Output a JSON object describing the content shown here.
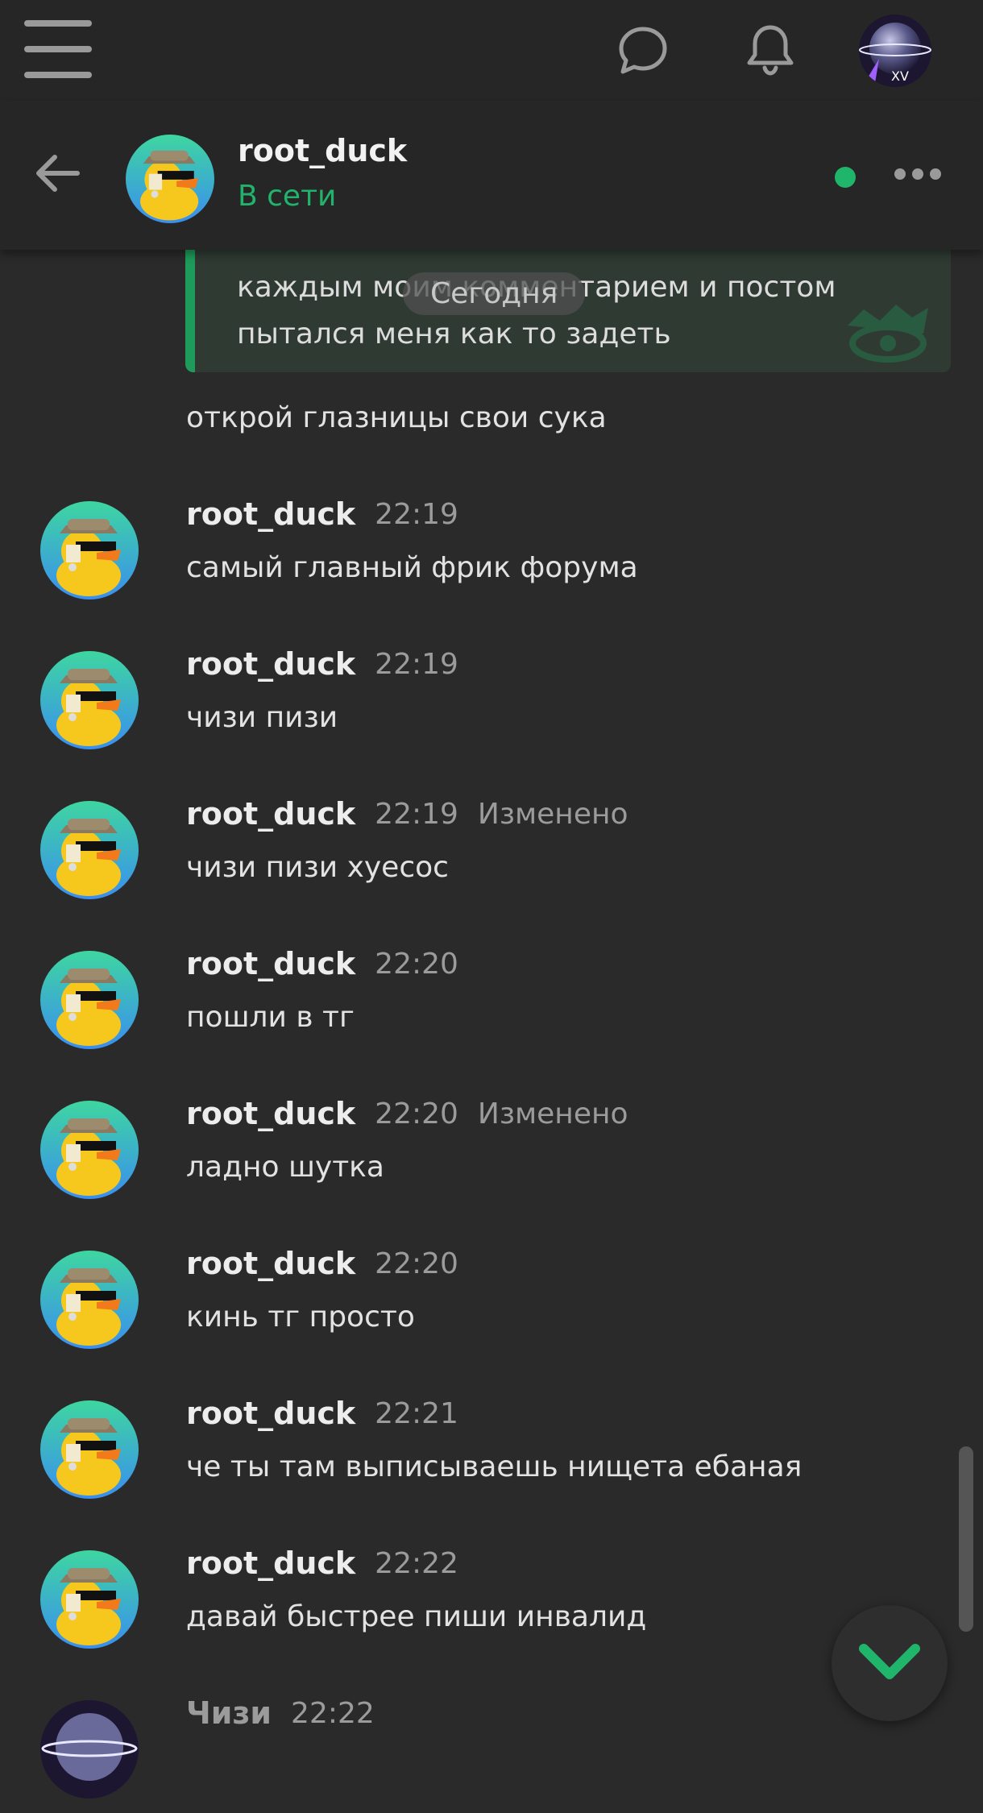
{
  "topbar": {
    "menu_icon": "hamburger-icon",
    "chat_icon": "chat-bubble-icon",
    "bell_icon": "bell-icon",
    "avatar_icon": "user-avatar"
  },
  "header": {
    "back_icon": "arrow-left-icon",
    "name": "root_duck",
    "status": "В сети",
    "status_color": "#21b36b",
    "more_icon": "more-horizontal-icon"
  },
  "quote": {
    "lines": [
      "каждым моим комментарием и постом",
      "пытался меня как то задеть"
    ]
  },
  "date_divider": "Сегодня",
  "standalone_message": "открой глазницы свои сука",
  "messages": [
    {
      "author": "root_duck",
      "time": "22:19",
      "edited": "",
      "text": "самый главный фрик форума"
    },
    {
      "author": "root_duck",
      "time": "22:19",
      "edited": "",
      "text": "чизи пизи"
    },
    {
      "author": "root_duck",
      "time": "22:19",
      "edited": "Изменено",
      "text": "чизи пизи хуесос"
    },
    {
      "author": "root_duck",
      "time": "22:20",
      "edited": "",
      "text": "пошли в тг"
    },
    {
      "author": "root_duck",
      "time": "22:20",
      "edited": "Изменено",
      "text": "ладно шутка"
    },
    {
      "author": "root_duck",
      "time": "22:20",
      "edited": "",
      "text": "кинь тг просто"
    },
    {
      "author": "root_duck",
      "time": "22:21",
      "edited": "",
      "text": "че ты там выписываешь нищета ебаная"
    },
    {
      "author": "root_duck",
      "time": "22:22",
      "edited": "",
      "text": "давай быстрее пиши инвалид"
    },
    {
      "author": "Чизи",
      "time": "22:22",
      "edited": "",
      "text": ""
    }
  ],
  "scroll_down_icon": "chevron-down-icon"
}
